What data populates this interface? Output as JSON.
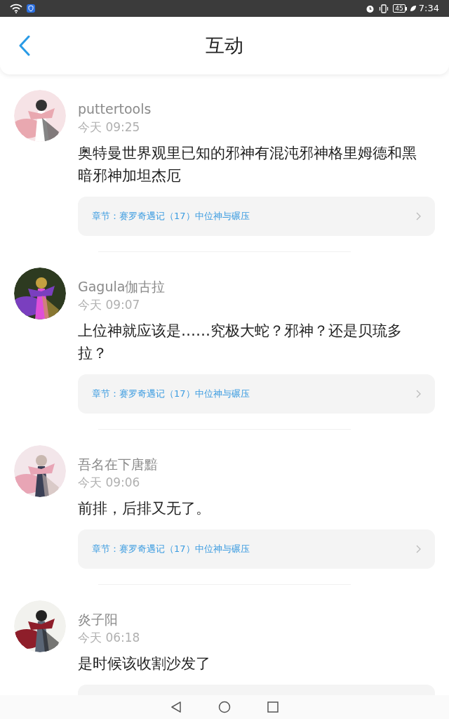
{
  "status_bar": {
    "battery": "45",
    "time": "7:34"
  },
  "header": {
    "title": "互动"
  },
  "comments": [
    {
      "user": "puttertools",
      "time": "今天 09:25",
      "text": "奥特曼世界观里已知的邪神有混沌邪神格里姆德和黑暗邪神加坦杰厄",
      "chapter": "章节：赛罗奇遇记（17）中位神与碾压"
    },
    {
      "user": "Gagula伽古拉",
      "time": "今天 09:07",
      "text": "上位神就应该是……究极大蛇？邪神？还是贝琉多拉？",
      "chapter": "章节：赛罗奇遇记（17）中位神与碾压"
    },
    {
      "user": "吾名在下唐黯",
      "time": "今天 09:06",
      "text": "前排，后排又无了。",
      "chapter": "章节：赛罗奇遇记（17）中位神与碾压"
    },
    {
      "user": "炎子阳",
      "time": "今天 06:18",
      "text": "是时候该收割沙发了"
    }
  ]
}
